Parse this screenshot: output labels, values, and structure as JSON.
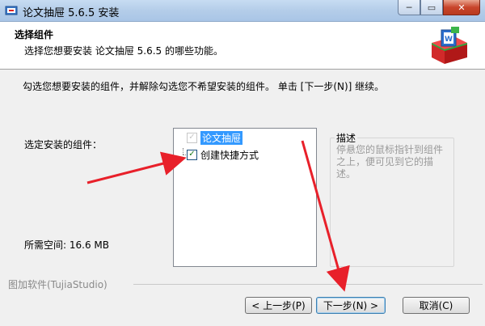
{
  "window": {
    "title": "论文抽屉 5.6.5 安装",
    "minimize": "─",
    "maximize": "▭",
    "close": "✕"
  },
  "header": {
    "title": "选择组件",
    "subtitle": "选择您想要安装 论文抽屉 5.6.5 的哪些功能。"
  },
  "main": {
    "instruction": "勾选您想要安装的组件，并解除勾选您不希望安装的组件。 单击 [下一步(N)] 继续。",
    "select_label": "选定安装的组件：",
    "space_label": "所需空间: 16.6 MB",
    "components": [
      {
        "label": "论文抽屉",
        "checked": true,
        "disabled": true,
        "selected": true
      },
      {
        "label": "创建快捷方式",
        "checked": true,
        "disabled": false,
        "selected": false
      }
    ],
    "description": {
      "title": "描述",
      "text": "停悬您的鼠标指针到组件之上，便可见到它的描述。"
    },
    "brand": "图加软件(TujiaStudio)"
  },
  "buttons": {
    "back": "< 上一步(P)",
    "next": "下一步(N) >",
    "cancel": "取消(C)"
  },
  "colors": {
    "selection": "#3399ff",
    "annotation_arrow": "#e8202a"
  }
}
